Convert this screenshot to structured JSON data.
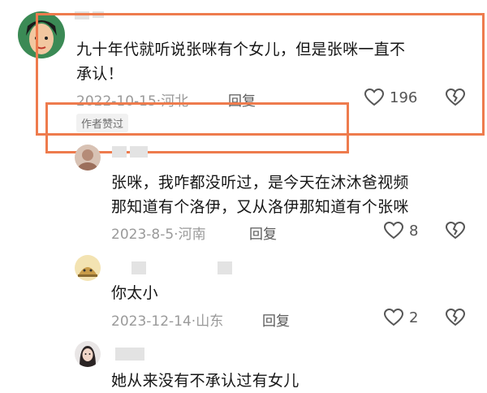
{
  "comments": [
    {
      "text_line1": "九十年代就听说张咪有个女儿，但是张咪一直不",
      "text_line2": "承认！",
      "date": "2022-10-15",
      "location": "河北",
      "reply_label": "回复",
      "likes": "196",
      "badge": "作者赞过"
    },
    {
      "text_line1": "张咪，我咋都没听过，是今天在沐沐爸视频",
      "text_line2": "那知道有个洛伊，又从洛伊那知道有个张咪",
      "date": "2023-8-5",
      "location": "河南",
      "reply_label": "回复",
      "likes": "8"
    },
    {
      "text_line1": "你太小",
      "date": "2023-12-14",
      "location": "山东",
      "reply_label": "回复",
      "likes": "2"
    },
    {
      "text_line1": "她从来没有不承认过有女儿"
    }
  ],
  "separator": "·",
  "icons": {
    "like": "heart-outline-icon",
    "dislike": "broken-heart-icon"
  },
  "colors": {
    "highlight_box": "#ee7b4d"
  }
}
